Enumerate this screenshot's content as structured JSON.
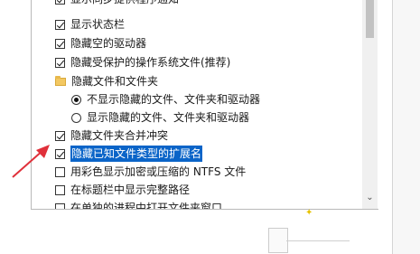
{
  "options": {
    "top_partial": "显示同步提供程序通知",
    "status_bar": "显示状态栏",
    "hide_empty_drives": "隐藏空的驱动器",
    "hide_protected_os_files": "隐藏受保护的操作系统文件(推荐)",
    "hidden_files_folder": "隐藏文件和文件夹",
    "radio_hide": "不显示隐藏的文件、文件夹和驱动器",
    "radio_show": "显示隐藏的文件、文件夹和驱动器",
    "hide_merge_conflicts": "隐藏文件夹合并冲突",
    "hide_extensions": "隐藏已知文件类型的扩展名",
    "color_encrypted": "用彩色显示加密或压缩的 NTFS 文件",
    "full_path_title": "在标题栏中显示完整路径",
    "separate_process_partial": "在单独的进程中打开文件夹窗口"
  },
  "state": {
    "top_partial": true,
    "status_bar": true,
    "hide_empty_drives": true,
    "hide_protected_os_files": true,
    "radio_selected": "radio_hide",
    "hide_merge_conflicts": true,
    "hide_extensions": true,
    "color_encrypted": false,
    "full_path_title": false,
    "separate_process_partial": false
  },
  "icons": {
    "folder": "folder-icon",
    "annotation_arrow": "red-arrow-icon",
    "scroll_down": "chevron-down-icon"
  },
  "colors": {
    "highlight": "#0a64c8",
    "annotation": "#e0303a"
  }
}
